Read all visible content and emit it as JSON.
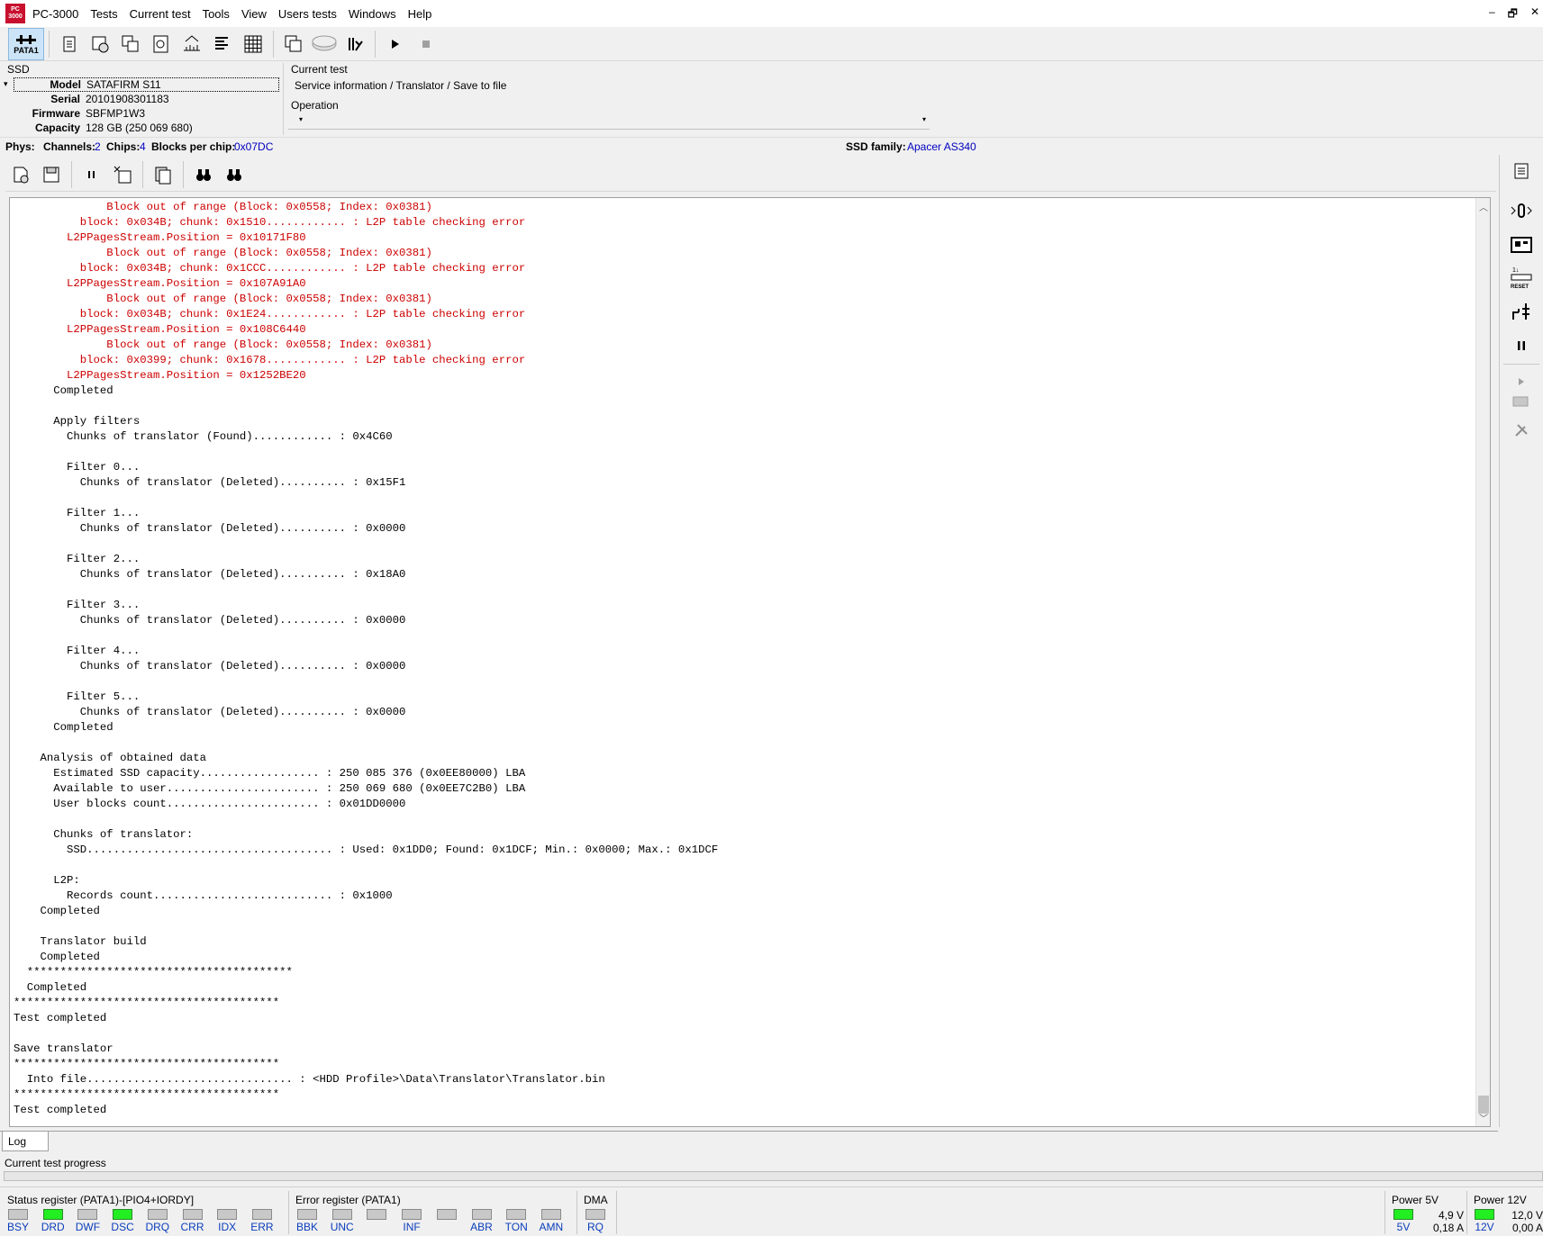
{
  "app": {
    "title": "PC-3000",
    "logo_text": "PC 3000",
    "menu": [
      "Tests",
      "Current test",
      "Tools",
      "View",
      "Users tests",
      "Windows",
      "Help"
    ],
    "window_controls": [
      "–",
      "🗗",
      "✕"
    ]
  },
  "toolbar": {
    "pata_label": "PATA1",
    "icons": [
      "scroll-info-icon",
      "chip-gear-icon",
      "chips-stack-icon",
      "chip-badge-icon",
      "ruler-icon",
      "list-icon",
      "grid-icon",
      "copy-panels-icon",
      "disk-icon",
      "runner-icon",
      "play-icon",
      "stop-icon"
    ]
  },
  "device": {
    "type": "SSD",
    "model_label": "Model",
    "model": "SATAFIRM   S11",
    "serial_label": "Serial",
    "serial": "20101908301183",
    "firmware_label": "Firmware",
    "firmware": "SBFMP1W3",
    "capacity_label": "Capacity",
    "capacity": "128 GB (250 069 680)"
  },
  "current_test": {
    "heading": "Current test",
    "value": "Service information / Translator / Save to file",
    "operation_heading": "Operation",
    "operation_value": ""
  },
  "phys": {
    "phys_label": "Phys:",
    "channels_label": "Channels:",
    "channels": "2",
    "chips_label": "Chips:",
    "chips": "4",
    "blocks_label": "Blocks per chip:",
    "blocks": "0x07DC",
    "family_label": "SSD family:",
    "family": "Apacer AS340"
  },
  "log": {
    "tab_label": "Log",
    "lines": [
      {
        "t": "              Block out of range (Block: 0x0558; Index: 0x0381)",
        "c": "red"
      },
      {
        "t": "          block: 0x034B; chunk: 0x1510............ : L2P table checking error",
        "c": "red"
      },
      {
        "t": "        L2PPagesStream.Position = 0x10171F80",
        "c": "red"
      },
      {
        "t": "              Block out of range (Block: 0x0558; Index: 0x0381)",
        "c": "red"
      },
      {
        "t": "          block: 0x034B; chunk: 0x1CCC............ : L2P table checking error",
        "c": "red"
      },
      {
        "t": "        L2PPagesStream.Position = 0x107A91A0",
        "c": "red"
      },
      {
        "t": "              Block out of range (Block: 0x0558; Index: 0x0381)",
        "c": "red"
      },
      {
        "t": "          block: 0x034B; chunk: 0x1E24............ : L2P table checking error",
        "c": "red"
      },
      {
        "t": "        L2PPagesStream.Position = 0x108C6440",
        "c": "red"
      },
      {
        "t": "              Block out of range (Block: 0x0558; Index: 0x0381)",
        "c": "red"
      },
      {
        "t": "          block: 0x0399; chunk: 0x1678............ : L2P table checking error",
        "c": "red"
      },
      {
        "t": "        L2PPagesStream.Position = 0x1252BE20",
        "c": "red"
      },
      {
        "t": "      Completed",
        "c": "black"
      },
      {
        "t": "",
        "c": "black"
      },
      {
        "t": "      Apply filters",
        "c": "black"
      },
      {
        "t": "        Chunks of translator (Found)............ : 0x4C60",
        "c": "black"
      },
      {
        "t": "",
        "c": "black"
      },
      {
        "t": "        Filter 0...",
        "c": "black"
      },
      {
        "t": "          Chunks of translator (Deleted).......... : 0x15F1",
        "c": "black"
      },
      {
        "t": "",
        "c": "black"
      },
      {
        "t": "        Filter 1...",
        "c": "black"
      },
      {
        "t": "          Chunks of translator (Deleted).......... : 0x0000",
        "c": "black"
      },
      {
        "t": "",
        "c": "black"
      },
      {
        "t": "        Filter 2...",
        "c": "black"
      },
      {
        "t": "          Chunks of translator (Deleted).......... : 0x18A0",
        "c": "black"
      },
      {
        "t": "",
        "c": "black"
      },
      {
        "t": "        Filter 3...",
        "c": "black"
      },
      {
        "t": "          Chunks of translator (Deleted).......... : 0x0000",
        "c": "black"
      },
      {
        "t": "",
        "c": "black"
      },
      {
        "t": "        Filter 4...",
        "c": "black"
      },
      {
        "t": "          Chunks of translator (Deleted).......... : 0x0000",
        "c": "black"
      },
      {
        "t": "",
        "c": "black"
      },
      {
        "t": "        Filter 5...",
        "c": "black"
      },
      {
        "t": "          Chunks of translator (Deleted).......... : 0x0000",
        "c": "black"
      },
      {
        "t": "      Completed",
        "c": "black"
      },
      {
        "t": "",
        "c": "black"
      },
      {
        "t": "    Analysis of obtained data",
        "c": "black"
      },
      {
        "t": "      Estimated SSD capacity.................. : 250 085 376 (0x0EE80000) LBA",
        "c": "black"
      },
      {
        "t": "      Available to user....................... : 250 069 680 (0x0EE7C2B0) LBA",
        "c": "black"
      },
      {
        "t": "      User blocks count....................... : 0x01DD0000",
        "c": "black"
      },
      {
        "t": "",
        "c": "black"
      },
      {
        "t": "      Chunks of translator:",
        "c": "black"
      },
      {
        "t": "        SSD..................................... : Used: 0x1DD0; Found: 0x1DCF; Min.: 0x0000; Max.: 0x1DCF",
        "c": "black"
      },
      {
        "t": "",
        "c": "black"
      },
      {
        "t": "      L2P:",
        "c": "black"
      },
      {
        "t": "        Records count........................... : 0x1000",
        "c": "black"
      },
      {
        "t": "    Completed",
        "c": "black"
      },
      {
        "t": "",
        "c": "black"
      },
      {
        "t": "    Translator build",
        "c": "black"
      },
      {
        "t": "    Completed",
        "c": "black"
      },
      {
        "t": "  ****************************************",
        "c": "black"
      },
      {
        "t": "  Completed",
        "c": "black"
      },
      {
        "t": "****************************************",
        "c": "black"
      },
      {
        "t": "Test completed",
        "c": "black"
      },
      {
        "t": "",
        "c": "black"
      },
      {
        "t": "Save translator",
        "c": "black"
      },
      {
        "t": "****************************************",
        "c": "black"
      },
      {
        "t": "  Into file............................... : <HDD Profile>\\Data\\Translator\\Translator.bin",
        "c": "black"
      },
      {
        "t": "****************************************",
        "c": "black"
      },
      {
        "t": "Test completed",
        "c": "black"
      }
    ]
  },
  "progress": {
    "label": "Current test progress",
    "value": 0
  },
  "status_register": {
    "title": "Status register (PATA1)-[PIO4+IORDY]",
    "leds": [
      {
        "label": "BSY",
        "on": false
      },
      {
        "label": "DRD",
        "on": true
      },
      {
        "label": "DWF",
        "on": false
      },
      {
        "label": "DSC",
        "on": true
      },
      {
        "label": "DRQ",
        "on": false
      },
      {
        "label": "CRR",
        "on": false
      },
      {
        "label": "IDX",
        "on": false
      },
      {
        "label": "ERR",
        "on": false
      }
    ]
  },
  "error_register": {
    "title": "Error register (PATA1)",
    "leds": [
      {
        "label": "BBK",
        "on": false
      },
      {
        "label": "UNC",
        "on": false
      },
      {
        "label": "",
        "on": false
      },
      {
        "label": "INF",
        "on": false
      },
      {
        "label": "",
        "on": false
      },
      {
        "label": "ABR",
        "on": false
      },
      {
        "label": "TON",
        "on": false
      },
      {
        "label": "AMN",
        "on": false
      }
    ]
  },
  "dma": {
    "title": "DMA",
    "leds": [
      {
        "label": "RQ",
        "on": false
      }
    ]
  },
  "power5": {
    "title": "Power 5V",
    "led_label": "5V",
    "on": true,
    "voltage": "4,9 V",
    "current": "0,18 A"
  },
  "power12": {
    "title": "Power 12V",
    "led_label": "12V",
    "on": true,
    "voltage": "12,0 V",
    "current": "0,00 A"
  },
  "colors": {
    "log_error": "#cc0000",
    "link_blue": "#0000c0",
    "led_on": "#22ee22",
    "led_off": "#c8c8c8"
  }
}
